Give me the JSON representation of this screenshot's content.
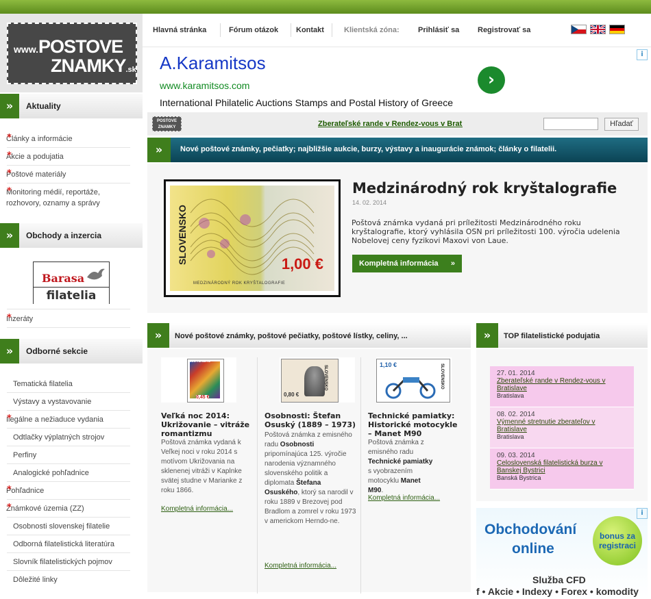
{
  "logo": {
    "prefix": "www.",
    "line1": "POSTOVE",
    "line2": "ZNAMKY",
    "suffix": ".sk",
    "mini": "POSTOVE ZNAMKY"
  },
  "nav": {
    "home": "Hlavná stránka",
    "forum": "Fórum otázok",
    "contact": "Kontakt",
    "client_zone": "Klientská zóna:",
    "login": "Prihlásiť sa",
    "register": "Registrovať sa",
    "languages": [
      "cz-flag-icon",
      "uk-flag-icon",
      "de-flag-icon"
    ]
  },
  "ad_top": {
    "title": "A.Karamitsos",
    "url": "www.karamitsos.com",
    "description": "International Philatelic Auctions Stamps and Postal History of Greece",
    "arrow": "›",
    "badge": "i"
  },
  "ticker": {
    "text": "Zberateľské rande v Rendez-vous v Bratislave"
  },
  "search": {
    "placeholder": "",
    "button": "Hľadať"
  },
  "sidebar": {
    "sections": [
      {
        "title": "Aktuality",
        "items": [
          "Články a informácie",
          "Akcie a podujatia",
          "Poštové materiály",
          "Monitoring médií, reportáže, rozhovory, oznamy a správy"
        ]
      },
      {
        "title": "Obchody a inzercia",
        "banner": {
          "line1": "Barasa",
          "line2": "filatelia"
        },
        "items": [
          "Inzeráty"
        ]
      },
      {
        "title": "Odborné sekcie",
        "items": [
          "Tematická filatelia",
          "Výstavy a vystavovanie",
          "Ilegálne a nežiaduce vydania",
          "Odtlačky výplatných strojov",
          "Perfiny",
          "Analogické pohľadnice",
          "Pohľadnice",
          "Známkové územia (ZZ)",
          "Osobnosti slovenskej filatelie",
          "Odborná filatelistická literatúra",
          "Slovník filatelistických pojmov",
          "Dôležité linky"
        ]
      }
    ],
    "star": "*"
  },
  "banner": {
    "chevron": "»",
    "text": "Nové poštové známky, pečiatky; najbližšie aukcie, burzy, výstavy a inaugurácie známok; články o filatelii."
  },
  "feature": {
    "stamp_country": "SLOVENSKO",
    "stamp_value": "1,00 €",
    "stamp_caption": "MEDZINÁRODNÝ ROK KRYŠTALOGRAFIE",
    "title": "Medzinárodný rok kryštalografie",
    "date": "14. 02. 2014",
    "description": "Poštová známka vydaná pri príležitosti Medzinárodného roku kryštalografie, ktorý vyhlásila OSN pri príležitosti 100. výročia udelenia Nobelovej ceny fyzikovi Maxovi von Laue.",
    "button": "Kompletná informácia",
    "button_chevron": "»"
  },
  "news_section": {
    "title": "Nové poštové známky, poštové pečiatky, poštové lístky, celiny, ...",
    "items": [
      {
        "stamp_country": "SLOVENSKO",
        "stamp_value": "0,45 €",
        "title": "Veľká noc 2014: Ukrižovanie – vitráže romantizmu",
        "text": "Poštová známka vydaná k Veľkej noci v roku 2014 s motívom Ukrižovania na sklenenej vitráži v Kaplnke svätej studne v Marianke z roku 1866.",
        "more": "Kompletná informácia..."
      },
      {
        "stamp_country": "SLOVENSKO",
        "stamp_value": "0,80 €",
        "title": "Osobnosti: Štefan Osuský (1889 – 1973)",
        "text_parts": [
          "Poštová známka z emisného radu ",
          "Osobnosti",
          " pripomínajúca 125. výročie narodenia významného slovenského politik a diplomata ",
          "Štefana Osuského",
          ", ktorý sa narodil v roku 1889 v Brezovej pod Bradlom a zomrel v roku 1973 v americkom Herndo-ne."
        ],
        "more": "Kompletná informácia..."
      },
      {
        "stamp_country": "SLOVENSKO",
        "stamp_value": "1,10 €",
        "title": "Technické pamiatky: Historické motocykle – Manet M90",
        "text_parts": [
          "Poštová známka z emisného radu ",
          "Technické pamiatky",
          " s vyobrazením motocyklu ",
          "Manet M90",
          "."
        ],
        "more": "Kompletná informácia..."
      }
    ]
  },
  "events_section": {
    "title": "TOP filatelistické podujatia",
    "items": [
      {
        "date": "27. 01. 2014",
        "title": "Zberateľské rande v Rendez-vous v Bratislave",
        "place": "Bratislava"
      },
      {
        "date": "08. 02. 2014",
        "title": "Výmenné stretnutie zberateľov v Bratislave",
        "place": "Bratislava"
      },
      {
        "date": "09. 03. 2014",
        "title": "Celoslovenská filatelistická burza v Banskej Bystrici",
        "place": "Banská Bystrica"
      }
    ]
  },
  "ad_bottom": {
    "line1": "Obchodování",
    "line2": "online",
    "bonus": "bonus za registraci",
    "service": "Služba CFD",
    "ticker": "f • Akcie • Indexy • Forex • komodity",
    "badge": "i"
  },
  "colors": {
    "brand_green": "#3f7e1c",
    "banner_teal": "#1a6073",
    "event_pink": "#f6c9ec"
  }
}
